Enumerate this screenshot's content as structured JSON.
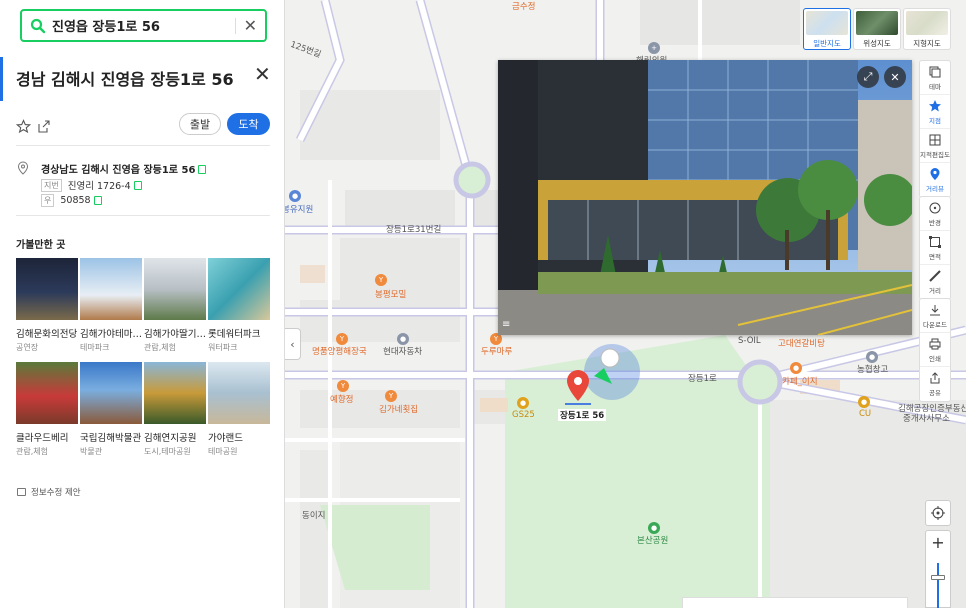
{
  "search": {
    "value": "진영읍 장등1로 56"
  },
  "place": {
    "title": "경남 김해시 진영읍 장등1로 56",
    "road_address": "경상남도 김해시 진영읍 장등1로 56",
    "jibun_tag": "지번",
    "jibun": "진영리 1726-4",
    "zip_tag": "우",
    "zip": "50858"
  },
  "actions": {
    "depart": "출발",
    "arrive": "도착"
  },
  "nearby": {
    "title": "가볼만한 곳",
    "items": [
      {
        "name": "김해문화의전당",
        "category": "공연장"
      },
      {
        "name": "김해가야테마파크",
        "category": "테마파크"
      },
      {
        "name": "김해가야딸기체험농장",
        "category": "관람,체험"
      },
      {
        "name": "롯데워터파크",
        "category": "워터파크"
      },
      {
        "name": "클라우드베리",
        "category": "관람,체험"
      },
      {
        "name": "국립김해박물관",
        "category": "박물관"
      },
      {
        "name": "김해연지공원",
        "category": "도시,테마공원"
      },
      {
        "name": "가야랜드",
        "category": "테마공원"
      }
    ]
  },
  "report_link": "정보수정 제안",
  "map_types": [
    {
      "label": "일반지도",
      "active": true
    },
    {
      "label": "위성지도",
      "active": false
    },
    {
      "label": "지형지도",
      "active": false
    }
  ],
  "tools": {
    "group1": [
      {
        "label": "테마",
        "icon": "layers-icon"
      },
      {
        "label": "지점",
        "icon": "star-icon",
        "active": true
      },
      {
        "label": "지적편집도",
        "icon": "cadastral-icon"
      },
      {
        "label": "거리뷰",
        "icon": "streetview-icon",
        "active": true
      }
    ],
    "group2": [
      {
        "label": "반경",
        "icon": "radius-icon"
      },
      {
        "label": "면적",
        "icon": "area-icon"
      },
      {
        "label": "거리",
        "icon": "ruler-icon"
      }
    ],
    "group3": [
      {
        "label": "다운로드",
        "icon": "download-icon"
      },
      {
        "label": "인쇄",
        "icon": "print-icon"
      },
      {
        "label": "공유",
        "icon": "share-icon"
      }
    ]
  },
  "map_labels": {
    "road_31": "장등1로31번길",
    "road_main": "장등1로",
    "road_125": "125번길",
    "marker": "장등1로 56",
    "bongpyeong": "봉평모밀",
    "myeongpum": "명품양평해장국",
    "hyundai": "현대자동차",
    "durumaru": "두루마루",
    "yehyang": "예향정",
    "gimne": "김가네횟집",
    "gs25": "GS25",
    "park": "본산공원",
    "dongeoji": "동이지",
    "soil": "S-OIL",
    "godae": "고대연갈비탕",
    "cafe": "카페_이지",
    "nonghyup": "농협창고",
    "cu": "CU",
    "realty": "김해공장인증부동산",
    "realty2": "중개사사무소",
    "hospital": "해림의원",
    "bongyu": "봉유지원",
    "top": "금수정"
  }
}
